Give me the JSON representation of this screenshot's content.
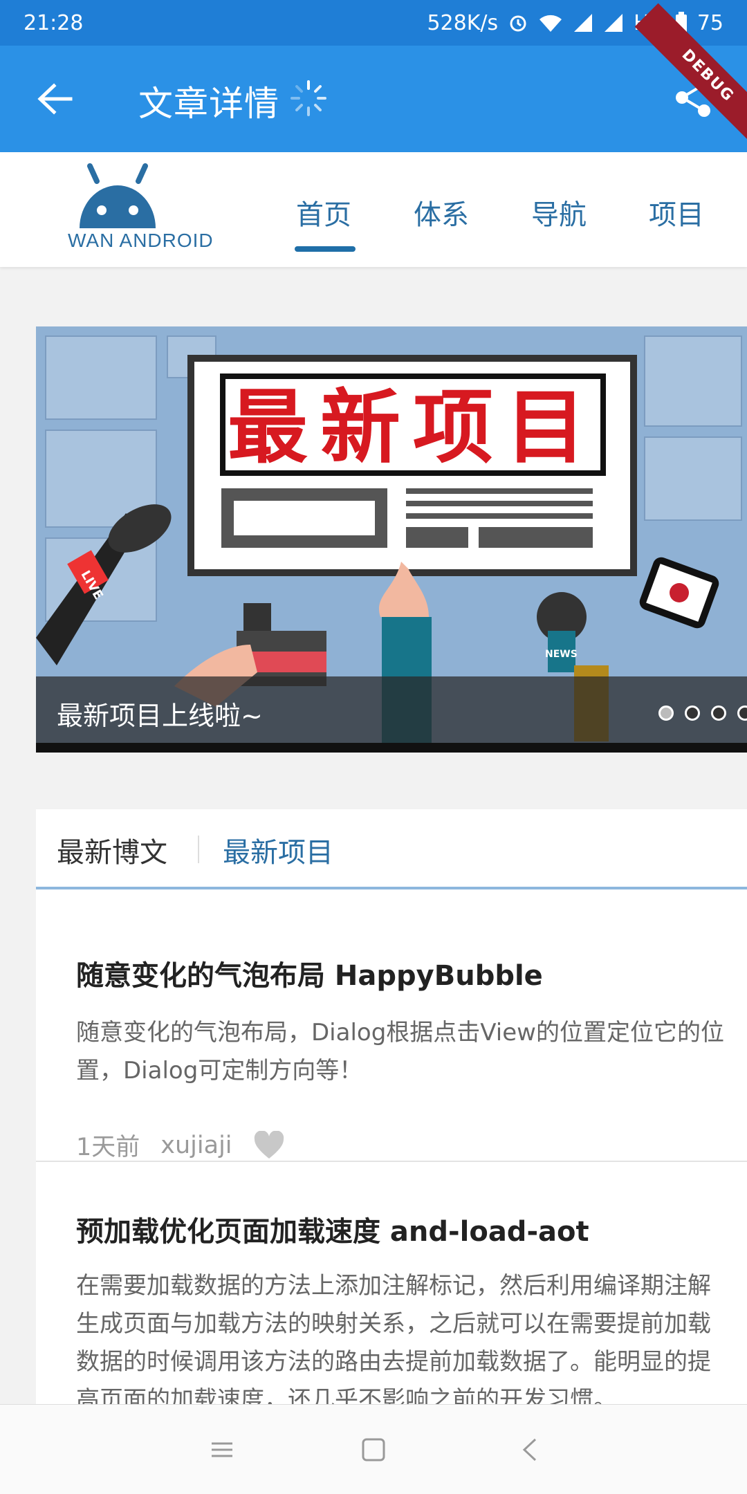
{
  "status_bar": {
    "time": "21:28",
    "network_speed": "528K/s",
    "hd_label": "HD",
    "battery_level": "75"
  },
  "app_bar": {
    "title": "文章详情",
    "debug_label": "DEBUG",
    "accent_color": "#2b91e6"
  },
  "logo": {
    "text": "WAN ANDROID"
  },
  "nav_tabs": [
    {
      "label": "首页",
      "active": true
    },
    {
      "label": "体系",
      "active": false
    },
    {
      "label": "导航",
      "active": false
    },
    {
      "label": "项目",
      "active": false
    }
  ],
  "banner": {
    "headline": "最新项目",
    "caption": "最新项目上线啦~",
    "live_label": "LIVE",
    "news_label": "NEWS",
    "page_count": 4,
    "active_page": 1
  },
  "content_tabs": [
    {
      "label": "最新博文",
      "active": false
    },
    {
      "label": "最新项目",
      "active": true
    }
  ],
  "articles": [
    {
      "title": "随意变化的气泡布局 HappyBubble",
      "desc_lines": [
        "随意变化的气泡布局，Dialog根据点击View的位置定位它的位",
        "置，Dialog可定制方向等！"
      ],
      "time": "1天前",
      "author": "xujiaji"
    },
    {
      "title": "预加载优化页面加载速度 and-load-aot",
      "desc_lines": [
        "在需要加载数据的方法上添加注解标记，然后利用编译期注解",
        "生成页面与加载方法的映射关系，之后就可以在需要提前加载",
        "数据的时候调用该方法的路由去提前加载数据了。能明显的提",
        "高页面的加载速度，还几乎不影响之前的开发习惯。"
      ]
    }
  ]
}
